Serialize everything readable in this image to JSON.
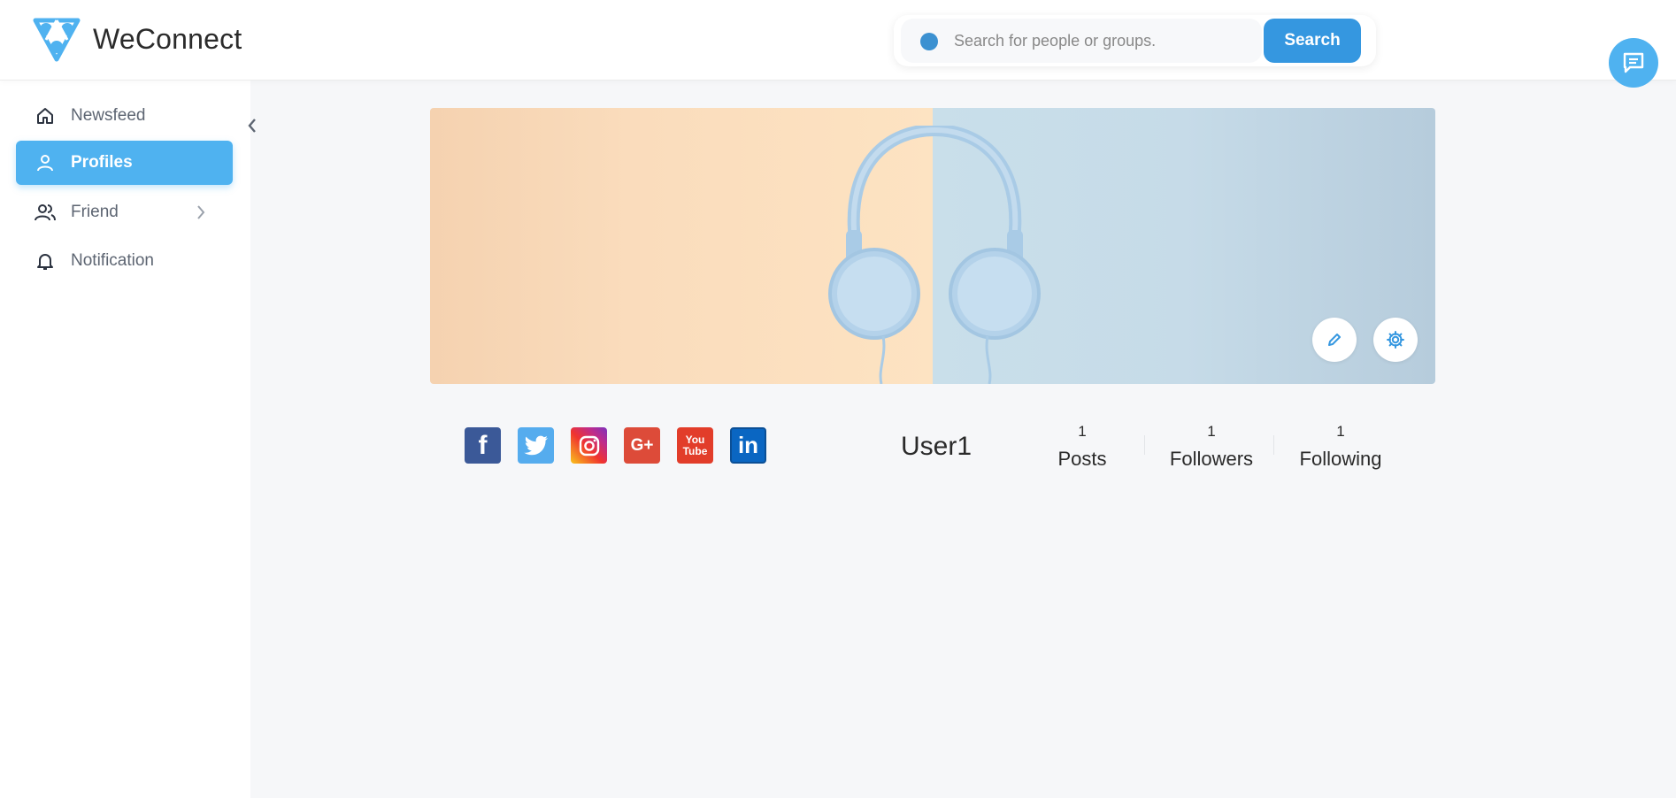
{
  "header": {
    "brand": "WeConnect",
    "search_placeholder": "Search for people or groups.",
    "search_button": "Search"
  },
  "sidebar": {
    "items": [
      {
        "label": "Newsfeed",
        "icon": "home-icon",
        "active": false
      },
      {
        "label": "Profiles",
        "icon": "user-icon",
        "active": true
      },
      {
        "label": "Friend",
        "icon": "users-icon",
        "active": false,
        "has_submenu": true
      },
      {
        "label": "Notification",
        "icon": "bell-icon",
        "active": false
      }
    ]
  },
  "profile": {
    "username": "User1",
    "social_links": [
      "facebook",
      "twitter",
      "instagram",
      "google-plus",
      "youtube",
      "linkedin"
    ],
    "stats": [
      {
        "value": "1",
        "label": "Posts"
      },
      {
        "value": "1",
        "label": "Followers"
      },
      {
        "value": "1",
        "label": "Following"
      }
    ]
  },
  "social_labels": {
    "facebook": "f",
    "google": "G+",
    "youtube": "You\nTube",
    "linkedin": "in"
  },
  "colors": {
    "accent": "#4fb2f0",
    "search_button": "#3597e0",
    "facebook": "#3b5998",
    "twitter": "#55acee",
    "google_plus": "#dd4b39",
    "youtube": "#e62117",
    "linkedin": "#0a66c2"
  }
}
